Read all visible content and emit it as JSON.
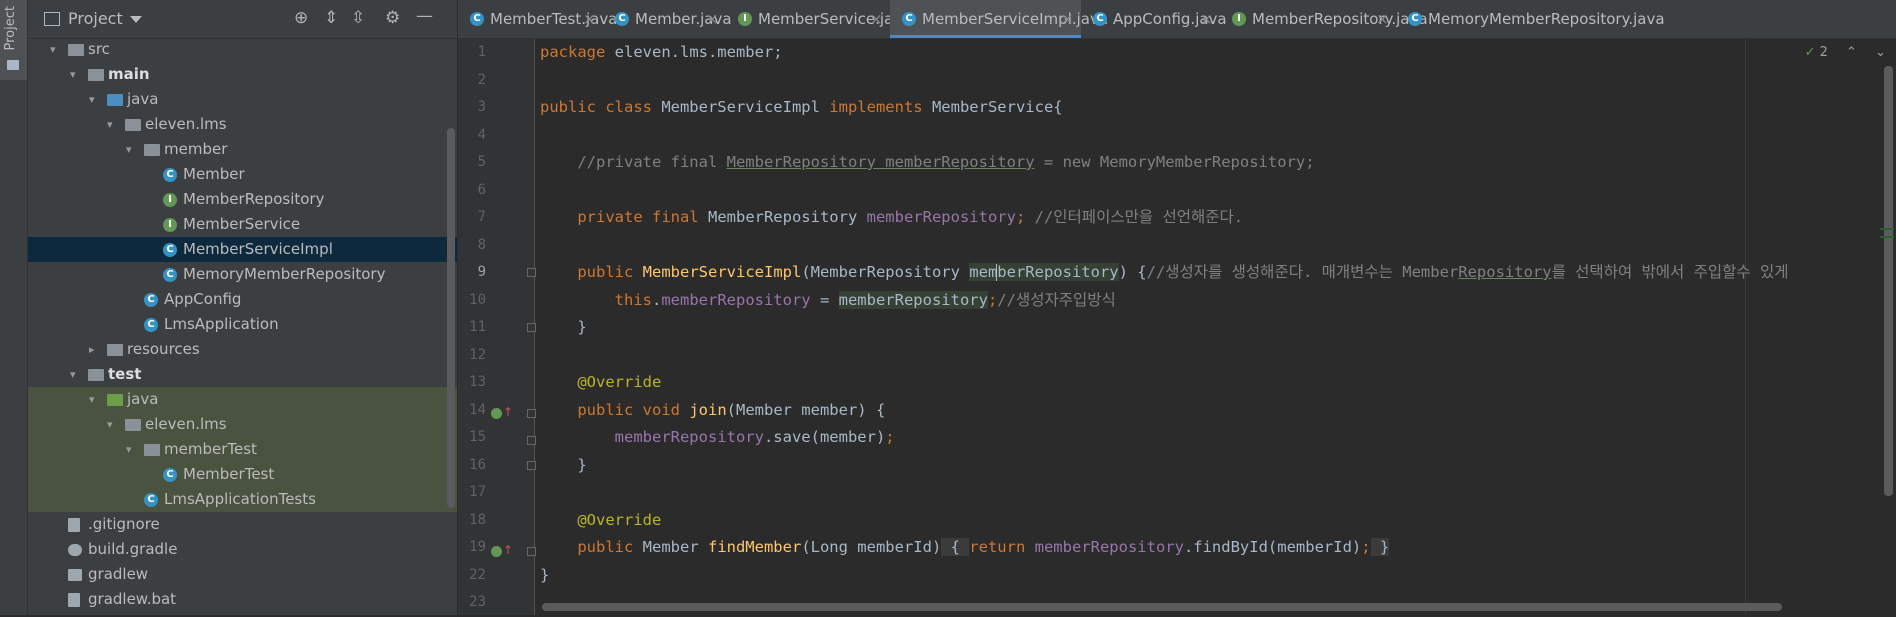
{
  "side_strip": {
    "label": "Project"
  },
  "project_panel": {
    "title": "Project",
    "header_buttons": [
      "locate-icon",
      "expand-all-icon",
      "collapse-all-icon",
      "gear-icon",
      "minimize-icon"
    ],
    "tree": [
      {
        "label": "src",
        "indent": 0,
        "expanded": true,
        "icon": "folder-icon"
      },
      {
        "label": "main",
        "indent": 1,
        "expanded": true,
        "icon": "folder-icon",
        "bold": true
      },
      {
        "label": "java",
        "indent": 2,
        "expanded": true,
        "icon": "source-folder-icon"
      },
      {
        "label": "eleven.lms",
        "indent": 3,
        "expanded": true,
        "icon": "package-icon"
      },
      {
        "label": "member",
        "indent": 4,
        "expanded": true,
        "icon": "package-icon"
      },
      {
        "label": "Member",
        "indent": 5,
        "icon": "class-icon"
      },
      {
        "label": "MemberRepository",
        "indent": 5,
        "icon": "interface-icon"
      },
      {
        "label": "MemberService",
        "indent": 5,
        "icon": "interface-icon"
      },
      {
        "label": "MemberServiceImpl",
        "indent": 5,
        "icon": "class-icon",
        "selected": true
      },
      {
        "label": "MemoryMemberRepository",
        "indent": 5,
        "icon": "class-icon"
      },
      {
        "label": "AppConfig",
        "indent": 4,
        "icon": "class-icon"
      },
      {
        "label": "LmsApplication",
        "indent": 4,
        "icon": "spring-class-icon"
      },
      {
        "label": "resources",
        "indent": 2,
        "expanded": false,
        "icon": "folder-icon"
      },
      {
        "label": "test",
        "indent": 1,
        "expanded": true,
        "icon": "folder-icon",
        "bold": true
      },
      {
        "label": "java",
        "indent": 2,
        "expanded": true,
        "icon": "test-folder-icon",
        "test": true
      },
      {
        "label": "eleven.lms",
        "indent": 3,
        "expanded": true,
        "icon": "package-icon",
        "test": true
      },
      {
        "label": "memberTest",
        "indent": 4,
        "expanded": true,
        "icon": "package-icon",
        "test": true
      },
      {
        "label": "MemberTest",
        "indent": 5,
        "icon": "test-class-icon",
        "test": true
      },
      {
        "label": "LmsApplicationTests",
        "indent": 4,
        "icon": "test-class-icon",
        "test": true
      },
      {
        "label": ".gitignore",
        "indent": 0,
        "icon": "file-icon"
      },
      {
        "label": "build.gradle",
        "indent": 0,
        "icon": "gradle-icon"
      },
      {
        "label": "gradlew",
        "indent": 0,
        "icon": "terminal-icon"
      },
      {
        "label": "gradlew.bat",
        "indent": 0,
        "icon": "file-icon"
      }
    ]
  },
  "tabs": [
    {
      "label": "MemberTest.java",
      "icon": "C",
      "color": "#3592c4"
    },
    {
      "label": "Member.java",
      "icon": "C",
      "color": "#3592c4"
    },
    {
      "label": "MemberService.java",
      "icon": "I",
      "color": "#629755"
    },
    {
      "label": "MemberServiceImpl.java",
      "icon": "C",
      "color": "#3592c4",
      "active": true
    },
    {
      "label": "AppConfig.java",
      "icon": "C",
      "color": "#3592c4"
    },
    {
      "label": "MemberRepository.java",
      "icon": "I",
      "color": "#629755"
    },
    {
      "label": "MemoryMemberRepository.java",
      "icon": "C",
      "color": "#3592c4"
    }
  ],
  "tab_close": "×",
  "editor": {
    "inspection_count": "2",
    "line_numbers": [
      "1",
      "2",
      "3",
      "4",
      "5",
      "6",
      "7",
      "8",
      "9",
      "10",
      "11",
      "12",
      "13",
      "14",
      "15",
      "16",
      "17",
      "18",
      "19",
      "22",
      "23"
    ],
    "code": {
      "l1_kw": "package",
      "l1_rest": " eleven.lms.member;",
      "l3_kw1": "public class",
      "l3_name": " MemberServiceImpl ",
      "l3_kw2": "implements",
      "l3_rest": " MemberService{",
      "l5_a": "//private final ",
      "l5_b": "MemberRepository memberRepository",
      "l5_c": " = new MemoryMemberRepository;",
      "l7_kw": "private final",
      "l7_type": " MemberRepository ",
      "l7_field": "memberRepository",
      "l7_semi": ";",
      "l7_cm": " //인터페이스만을 선언해준다.",
      "l9_kw": "public",
      "l9_fn": "MemberServiceImpl",
      "l9_args_a": "(MemberRepository ",
      "l9_param_a": "mem",
      "l9_param_b": "berRepository",
      "l9_args_b": ") {",
      "l9_cm_a": "//생성자를 생성해준다. 매개변수는 Member",
      "l9_cm_b": "Repository",
      "l9_cm_c": "를 선택하여 밖에서 주입할수 있게",
      "l10_kw": "this",
      "l10_dot": ".",
      "l10_field": "memberRepository",
      "l10_eq": " = ",
      "l10_param": "memberRepository",
      "l10_semi": ";",
      "l10_cm": "//생성자주입방식",
      "l11": "}",
      "l13_an": "@Override",
      "l14_kw": "public void",
      "l14_fn": "join",
      "l14_rest": "(Member member) {",
      "l15_field": "memberRepository",
      "l15_rest": ".save(member)",
      "l15_semi": ";",
      "l16": "}",
      "l18_an": "@Override",
      "l19_kw": "public",
      "l19_type": " Member ",
      "l19_fn": "findMember",
      "l19_args": "(Long memberId)",
      "l19_b1": " { ",
      "l19_ret": "return",
      "l19_field": " memberRepository",
      "l19_call": ".findById(memberId)",
      "l19_semi": ";",
      "l19_b2": " }",
      "l22": "}"
    }
  }
}
